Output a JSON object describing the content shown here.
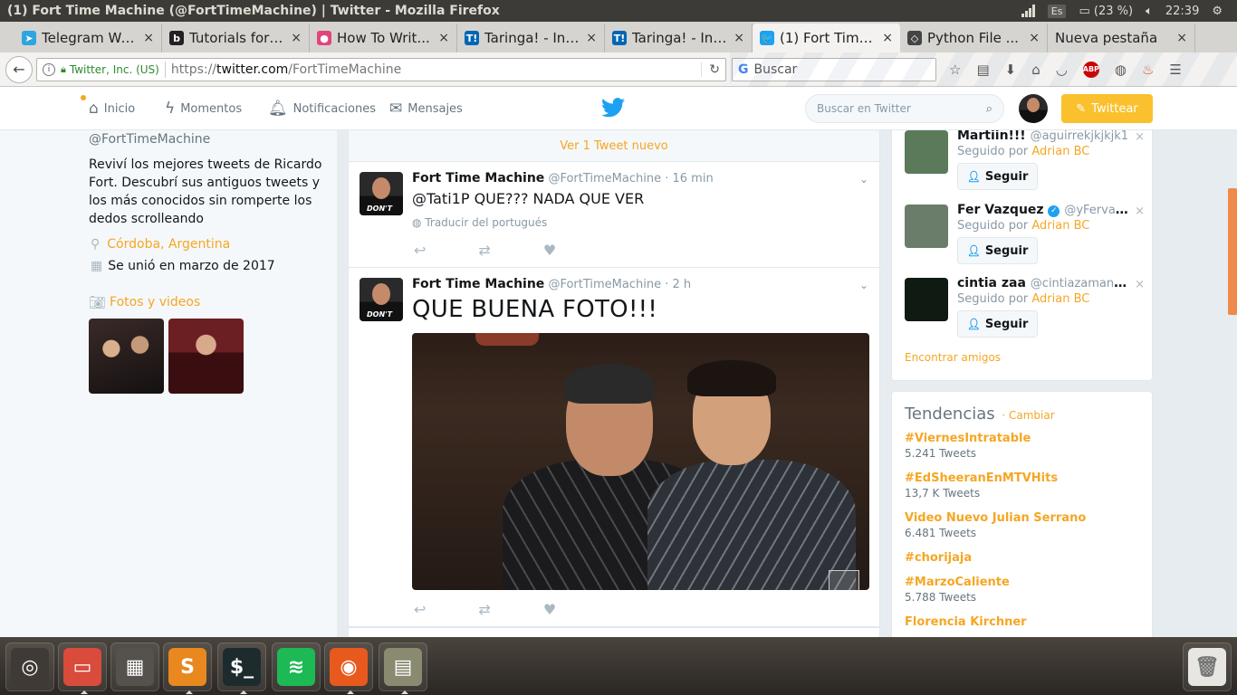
{
  "os": {
    "window_title": "(1) Fort Time Machine (@FortTimeMachine) | Twitter - Mozilla Firefox",
    "keyboard_layout": "Es",
    "battery": "(23 %)",
    "clock": "22:39"
  },
  "browser": {
    "tabs": [
      {
        "label": "Telegram Web",
        "icon": "telegram-icon",
        "color": "#2ca5e0",
        "glyph": "➤"
      },
      {
        "label": "Tutorials for ...",
        "icon": "b-icon",
        "color": "#222222",
        "glyph": "b"
      },
      {
        "label": "How To Writ...",
        "icon": "color-ring-icon",
        "color": "#e0457b",
        "glyph": "●"
      },
      {
        "label": "Taringa! - Int...",
        "icon": "taringa-icon",
        "color": "#0066b3",
        "glyph": "T!"
      },
      {
        "label": "Taringa! - Int...",
        "icon": "taringa-icon",
        "color": "#0066b3",
        "glyph": "T!"
      },
      {
        "label": "(1) Fort Time ...",
        "icon": "twitter-icon",
        "color": "#1da1f2",
        "glyph": "🐦"
      },
      {
        "label": "Python File ...",
        "icon": "diamond-icon",
        "color": "#444444",
        "glyph": "◇"
      },
      {
        "label": "Nueva pestaña",
        "icon": "none",
        "color": "#d6d4d0",
        "glyph": ""
      }
    ],
    "identity": "Twitter, Inc. (US)",
    "url_scheme": "https://",
    "url_host": "twitter.com",
    "url_path": "/FortTimeMachine",
    "search_placeholder": "Buscar",
    "abp_label": "ABP",
    "tab_close": "×"
  },
  "twitter_nav": {
    "items": [
      {
        "label": "Inicio",
        "icon": "home-icon"
      },
      {
        "label": "Momentos",
        "icon": "lightning-icon"
      },
      {
        "label": "Notificaciones",
        "icon": "bell-icon"
      },
      {
        "label": "Mensajes",
        "icon": "envelope-icon"
      }
    ],
    "search_placeholder": "Buscar en Twitter",
    "tweet_button": "Twittear"
  },
  "profile": {
    "handle": "@FortTimeMachine",
    "bio": "Reviví los mejores tweets de Ricardo Fort. Descubrí sus antiguos tweets y los más conocidos sin romperte los dedos scrolleando",
    "location": "Córdoba, Argentina",
    "joined": "Se unió en marzo de 2017",
    "media_label": "Fotos y videos"
  },
  "timeline": {
    "new_tweets_bar": "Ver 1 Tweet nuevo",
    "tweets": [
      {
        "name": "Fort Time Machine",
        "handle": "@FortTimeMachine",
        "time": "· 16 min",
        "text": "@Tati1P QUE??? NADA QUE VER",
        "translate": "Traducir del portugués",
        "avatar_text": "DON'T"
      },
      {
        "name": "Fort Time Machine",
        "handle": "@FortTimeMachine",
        "time": "· 2 h",
        "text": "QUE BUENA FOTO!!!",
        "avatar_text": "DON'T"
      }
    ]
  },
  "who_to_follow": {
    "items": [
      {
        "name": "Martiin!!!",
        "handle": "@aguirrekjkjkjk1",
        "followed_by": "Seguido por",
        "follower": "Adrian BC",
        "verified": false,
        "avatar_color": "#5a7a5a"
      },
      {
        "name": "Fer Vazquez",
        "handle": "@yFervaz...",
        "followed_by": "Seguido por",
        "follower": "Adrian BC",
        "verified": true,
        "avatar_color": "#6a7c6a"
      },
      {
        "name": "cintia zaa",
        "handle": "@cintiazamanieg2",
        "followed_by": "Seguido por",
        "follower": "Adrian BC",
        "verified": false,
        "avatar_color": "#0e1a12"
      }
    ],
    "follow_label": "Seguir",
    "dismiss": "×",
    "find_friends": "Encontrar amigos"
  },
  "trends": {
    "title": "Tendencias",
    "change": "· Cambiar",
    "items": [
      {
        "name": "#ViernesIntratable",
        "count": "5.241 Tweets"
      },
      {
        "name": "#EdSheeranEnMTVHits",
        "count": "13,7 K Tweets"
      },
      {
        "name": "Video Nuevo Julian Serrano",
        "count": "6.481 Tweets"
      },
      {
        "name": "#chorijaja",
        "count": ""
      },
      {
        "name": "#MarzoCaliente",
        "count": "5.788 Tweets"
      },
      {
        "name": "Florencia Kirchner",
        "count": ""
      }
    ]
  },
  "dock": {
    "items": [
      {
        "name": "ubuntu-dash",
        "glyph": "◎",
        "color": "#3f3a35"
      },
      {
        "name": "files-app",
        "glyph": "▭",
        "color": "#d94b3a"
      },
      {
        "name": "workspace-switcher",
        "glyph": "▦",
        "color": "#55524d"
      },
      {
        "name": "sublime-text",
        "glyph": "S",
        "color": "#e8881e"
      },
      {
        "name": "terminal",
        "glyph": "$_",
        "color": "#1e2b2e"
      },
      {
        "name": "spotify",
        "glyph": "≋",
        "color": "#1db954"
      },
      {
        "name": "firefox",
        "glyph": "◉",
        "color": "#e8591e"
      },
      {
        "name": "phone-app",
        "glyph": "▤",
        "color": "#8a8a70"
      }
    ],
    "trash": {
      "name": "trash",
      "glyph": "🗑"
    }
  }
}
